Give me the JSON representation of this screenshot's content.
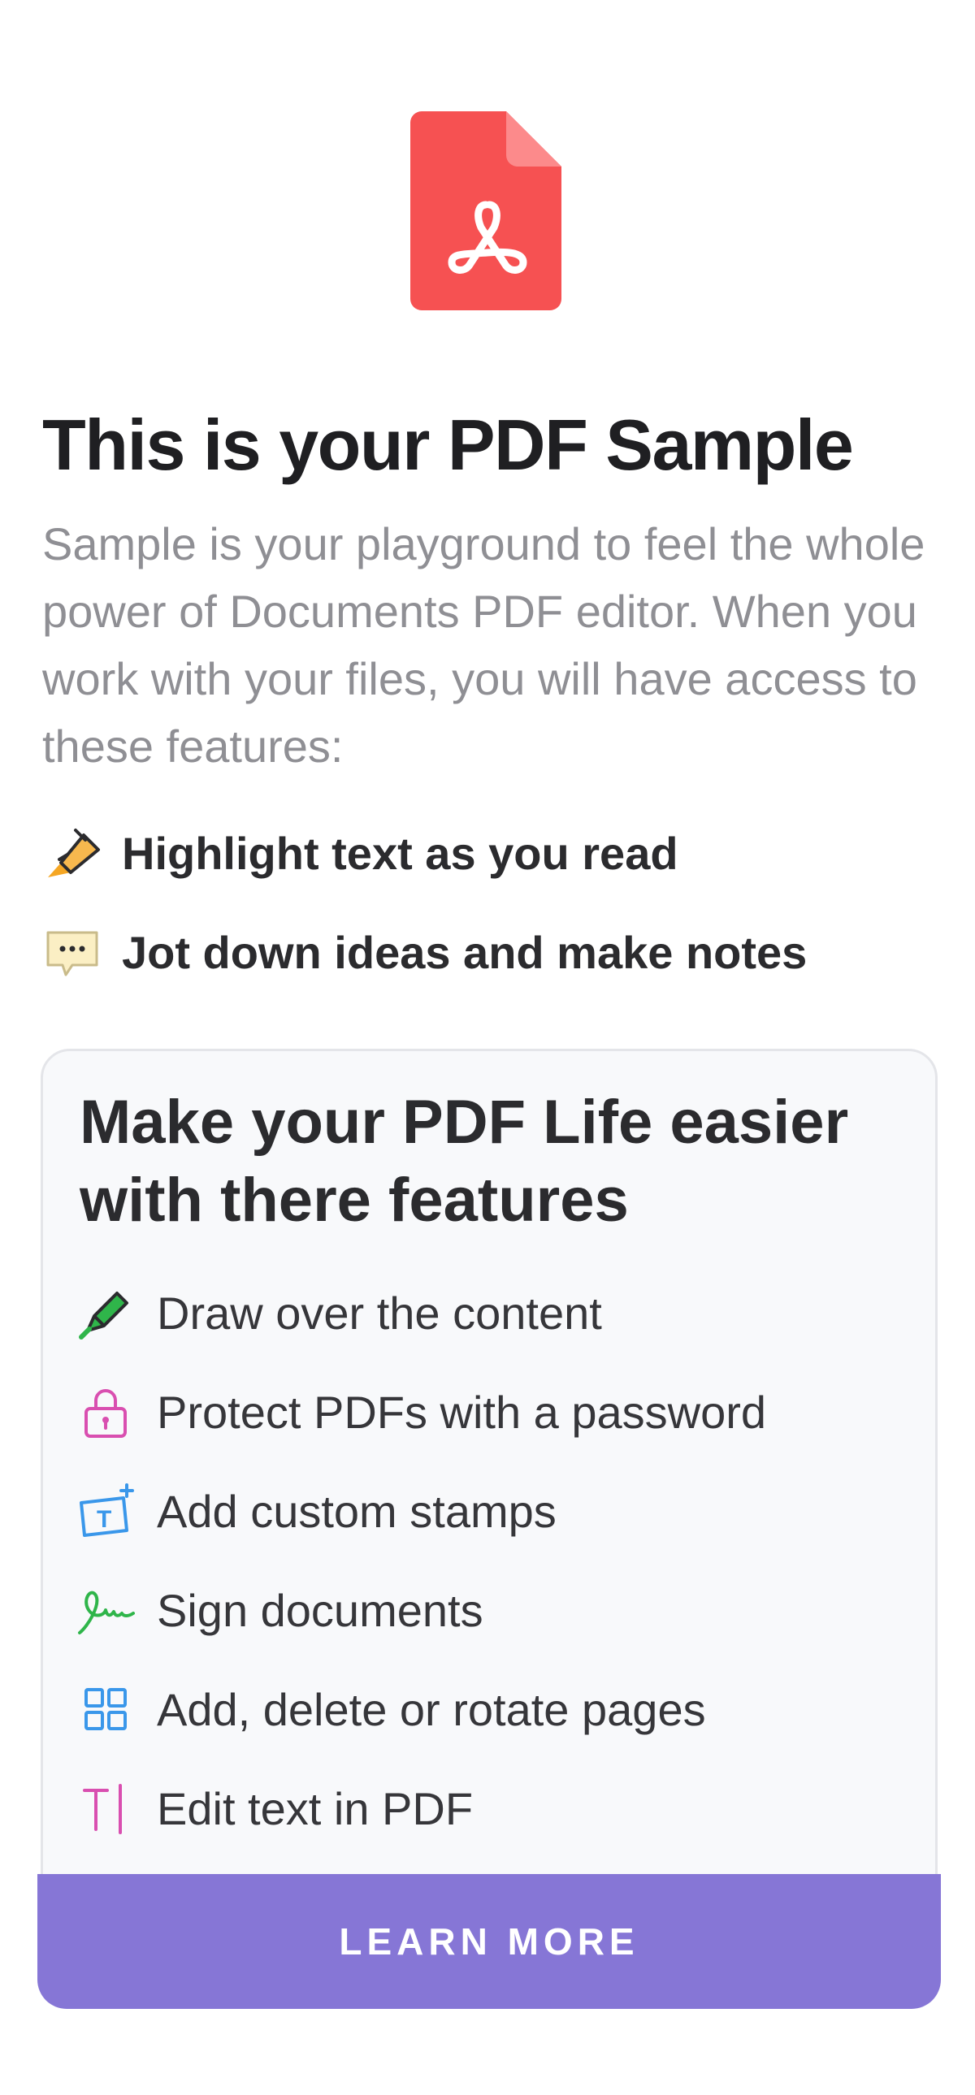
{
  "header": {
    "icon": "pdf-file-icon",
    "title": "This is your PDF Sample",
    "description": "Sample is your playground to feel the whole power of Documents PDF editor. When you work with your files, you will have access to these features:"
  },
  "features": [
    {
      "icon": "highlighter-icon",
      "label": "Highlight text as you read"
    },
    {
      "icon": "note-bubble-icon",
      "label": "Jot down ideas and make notes"
    }
  ],
  "card": {
    "title": "Make your PDF Life easier with there features",
    "items": [
      {
        "icon": "draw-pen-icon",
        "label": "Draw over the content"
      },
      {
        "icon": "lock-icon",
        "label": "Protect PDFs with a password"
      },
      {
        "icon": "stamp-icon",
        "label": "Add custom stamps"
      },
      {
        "icon": "signature-icon",
        "label": "Sign documents"
      },
      {
        "icon": "pages-grid-icon",
        "label": "Add, delete or rotate pages"
      },
      {
        "icon": "edit-text-icon",
        "label": "Edit text in PDF"
      }
    ],
    "button_label": "LEARN MORE"
  },
  "colors": {
    "pdf_red": "#f65152",
    "accent_purple": "#8676d6",
    "text_dark": "#1f1f22",
    "text_gray": "#8f8f94"
  }
}
